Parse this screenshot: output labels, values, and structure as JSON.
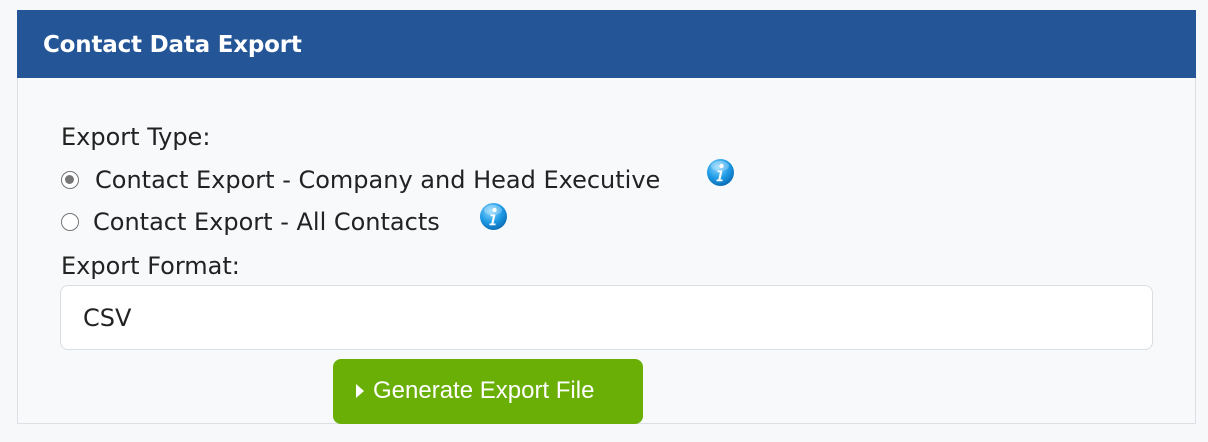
{
  "panel": {
    "title": "Contact Data Export"
  },
  "export_type": {
    "label": "Export Type:",
    "options": [
      {
        "label": "Contact Export - Company and Head Executive",
        "selected": true,
        "icon": "info-icon"
      },
      {
        "label": "Contact Export - All Contacts",
        "selected": false,
        "icon": "info-icon"
      }
    ]
  },
  "export_format": {
    "label": "Export Format:",
    "value": "CSV"
  },
  "generate_button": {
    "label": "Generate Export File",
    "icon": "caret-right-icon"
  },
  "colors": {
    "header": "#245597",
    "button": "#6aaf06",
    "info": "#1e9be6"
  }
}
